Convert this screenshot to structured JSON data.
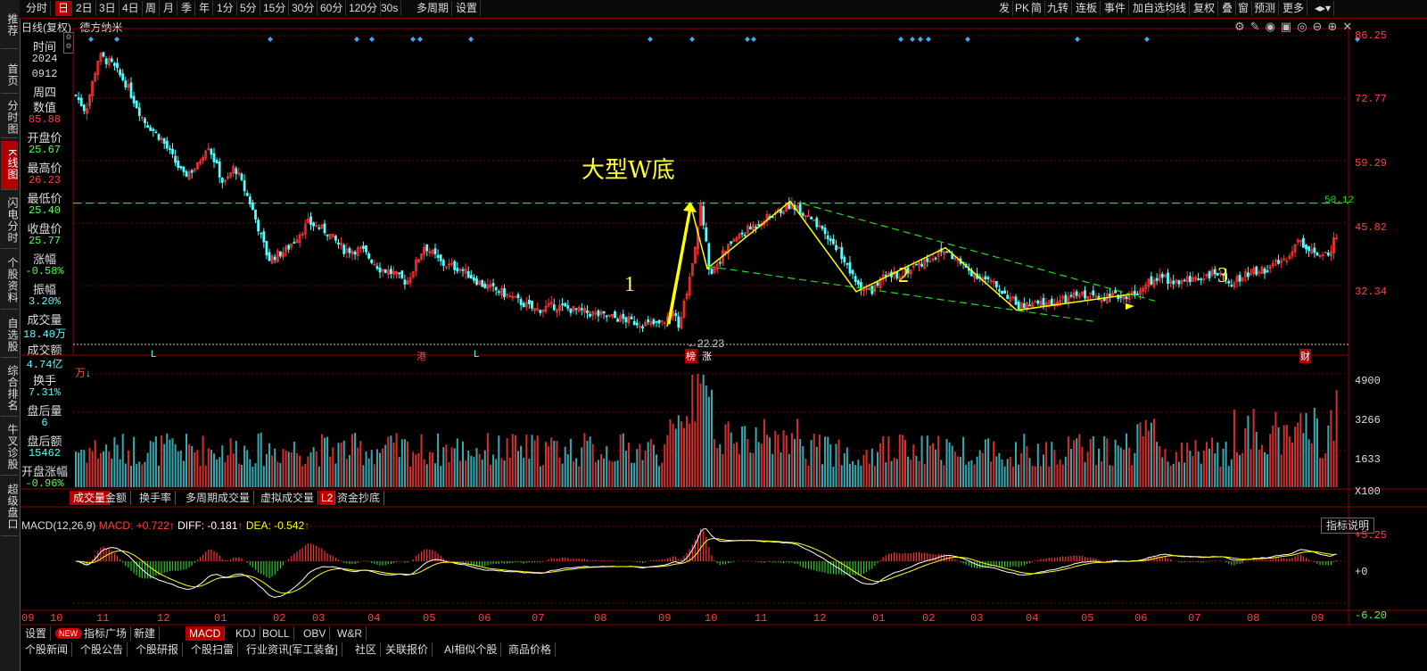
{
  "toolbar": {
    "left_items": [
      "分时",
      "日",
      "2日",
      "3日",
      "4日",
      "周",
      "月",
      "季",
      "年",
      "1分",
      "5分",
      "15分",
      "30分",
      "60分",
      "120分",
      "30s",
      "多周期",
      "设置"
    ],
    "right_items": [
      "发",
      "PK",
      "简",
      "九转",
      "连板",
      "事件",
      "加自选",
      "均线",
      "复权",
      "叠",
      "窗",
      "预测",
      "更多"
    ]
  },
  "sidebar": [
    "推荐",
    "首页",
    "分时图",
    "K线图",
    "闪电分时",
    "个股资料",
    "自选股",
    "综合排名",
    "牛叉诊股",
    "超级盘口"
  ],
  "chart_header": {
    "mode": "日线(复权)",
    "stock_name": "德方纳米"
  },
  "info_panel": [
    {
      "label": "时间",
      "value": "2024"
    },
    {
      "label": "",
      "value": "0912"
    },
    {
      "label": "周四",
      "value": ""
    },
    {
      "label": "数值",
      "value": "85.88"
    },
    {
      "label": "开盘价",
      "value": "25.67"
    },
    {
      "label": "最高价",
      "value": "26.23"
    },
    {
      "label": "最低价",
      "value": "25.40"
    },
    {
      "label": "收盘价",
      "value": "25.77"
    },
    {
      "label": "涨幅",
      "value": "-0.58%"
    },
    {
      "label": "振幅",
      "value": "3.20%"
    },
    {
      "label": "成交量",
      "value": "18.40万"
    },
    {
      "label": "成交额",
      "value": "4.74亿"
    },
    {
      "label": "换手",
      "value": "7.31%"
    },
    {
      "label": "盘后量",
      "value": "6"
    },
    {
      "label": "盘后额",
      "value": "15462"
    },
    {
      "label": "开盘涨幅",
      "value": "-0.96%"
    }
  ],
  "price_axis": [
    "86.25",
    "72.77",
    "59.29",
    "45.82",
    "32.34"
  ],
  "volume_axis": [
    "4900",
    "3266",
    "1633",
    "X100"
  ],
  "macd_axis": [
    "+5.25",
    "+0",
    "-6.20"
  ],
  "annotations": {
    "title": "大型W底",
    "label1": "1",
    "label2": "2",
    "label3": "3",
    "resistance": "50.12",
    "low_mark": "←22.23",
    "events": [
      "L",
      "港",
      "L",
      "榜",
      "涨",
      "财"
    ],
    "vol_unit": "万"
  },
  "vol_tabs": [
    "成交量",
    "金额",
    "换手率",
    "多周期成交量",
    "虚拟成交量",
    "L2",
    "资金抄底"
  ],
  "macd_header": {
    "name": "MACD(12,26,9)",
    "macd": "MACD: +0.722",
    "diff": "DIFF: -0.181",
    "dea": "DEA: -0.542",
    "explain": "指标说明"
  },
  "x_axis": [
    "09",
    "10",
    "11",
    "12",
    "01",
    "02",
    "03",
    "04",
    "05",
    "06",
    "07",
    "08",
    "09",
    "10",
    "11",
    "12",
    "01",
    "02",
    "03",
    "04",
    "05",
    "06",
    "07",
    "08",
    "09"
  ],
  "bottom_tabs": [
    "设置",
    "NEW",
    "指标广场",
    "新建",
    "MACD",
    "KDJ",
    "BOLL",
    "OBV",
    "W&R"
  ],
  "news_tabs": [
    "个股新闻",
    "个股公告",
    "个股研报",
    "个股扫雷",
    "行业资讯[军工装备]",
    "社区",
    "关联报价",
    "AI相似个股",
    "商品价格"
  ],
  "chart_data": {
    "type": "candlestick",
    "stock": "德方纳米",
    "period": "日线(复权)",
    "y_range": [
      22.23,
      86.25
    ],
    "y_ticks": [
      86.25,
      72.77,
      59.29,
      45.82,
      32.34
    ],
    "resistance_level": 50.12,
    "low_point": 22.23,
    "pattern": "大型W底",
    "volume_ticks": [
      4900,
      3266,
      1633
    ],
    "volume_unit": "X100",
    "macd_ticks": [
      5.25,
      0,
      -6.2
    ],
    "month_ticks": [
      "09",
      "10",
      "11",
      "12",
      "01",
      "02",
      "03",
      "04",
      "05",
      "06",
      "07",
      "08",
      "09",
      "10",
      "11",
      "12",
      "01",
      "02",
      "03",
      "04",
      "05",
      "06",
      "07",
      "08",
      "09"
    ],
    "colors": {
      "up": "#ff3232",
      "down": "#54ffff",
      "macd_line": "#ffffff",
      "signal_line": "#ffff00",
      "resistance": "#22dd22",
      "pattern_line": "#ffff00"
    }
  }
}
